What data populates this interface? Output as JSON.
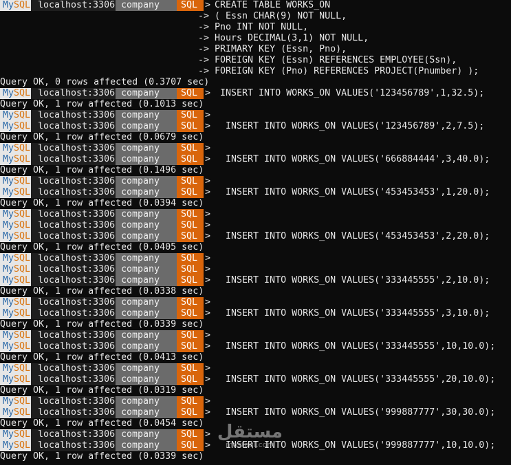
{
  "prompt": {
    "my": "My",
    "sql": "SQL",
    "host": "localhost:3306",
    "db": "company",
    "mode": "SQL",
    "arrow": ">"
  },
  "create_table": {
    "first": "CREATE TABLE WORKS_ON",
    "continuation_prefix": "->",
    "continuations": [
      "( Essn CHAR(9) NOT NULL,",
      "Pno INT NOT NULL,",
      "Hours DECIMAL(3,1) NOT NULL,",
      "PRIMARY KEY (Essn, Pno),",
      "FOREIGN KEY (Essn) REFERENCES EMPLOYEE(Ssn),",
      "FOREIGN KEY (Pno) REFERENCES PROJECT(Pnumber) );"
    ],
    "result": "Query OK, 0 rows affected (0.3707 sec)"
  },
  "inserts": [
    {
      "empty_prompts": 0,
      "command": "INSERT INTO WORKS_ON VALUES('123456789',1,32.5);",
      "result": "Query OK, 1 row affected (0.1013 sec)"
    },
    {
      "empty_prompts": 1,
      "command": "INSERT INTO WORKS_ON VALUES('123456789',2,7.5);",
      "result": "Query OK, 1 row affected (0.0679 sec)"
    },
    {
      "empty_prompts": 1,
      "command": "INSERT INTO WORKS_ON VALUES('666884444',3,40.0);",
      "result": "Query OK, 1 row affected (0.1496 sec)"
    },
    {
      "empty_prompts": 1,
      "command": "INSERT INTO WORKS_ON VALUES('453453453',1,20.0);",
      "result": "Query OK, 1 row affected (0.0394 sec)"
    },
    {
      "empty_prompts": 2,
      "command": "INSERT INTO WORKS_ON VALUES('453453453',2,20.0);",
      "result": "Query OK, 1 row affected (0.0405 sec)"
    },
    {
      "empty_prompts": 2,
      "command": "INSERT INTO WORKS_ON VALUES('333445555',2,10.0);",
      "result": "Query OK, 1 row affected (0.0338 sec)"
    },
    {
      "empty_prompts": 1,
      "command": "INSERT INTO WORKS_ON VALUES('333445555',3,10.0);",
      "result": "Query OK, 1 row affected (0.0339 sec)"
    },
    {
      "empty_prompts": 1,
      "command": "INSERT INTO WORKS_ON VALUES('333445555',10,10.0);",
      "result": "Query OK, 1 row affected (0.0413 sec)"
    },
    {
      "empty_prompts": 1,
      "command": "INSERT INTO WORKS_ON VALUES('333445555',20,10.0);",
      "result": "Query OK, 1 row affected (0.0319 sec)"
    },
    {
      "empty_prompts": 1,
      "command": "INSERT INTO WORKS_ON VALUES('999887777',30,30.0);",
      "result": "Query OK, 1 row affected (0.0454 sec)"
    },
    {
      "empty_prompts": 1,
      "command": "INSERT INTO WORKS_ON VALUES('999887777',10,10.0);",
      "result": "Query OK, 1 row affected (0.0339 sec)"
    }
  ],
  "watermark": {
    "arabic": "مستقل",
    "latin": "mostaql.com"
  },
  "colors": {
    "background": "#0c0c0c",
    "text": "#e6e6e6",
    "prompt_my": "#2d6aa8",
    "prompt_sql_accent": "#d9650b",
    "prompt_db_bg": "#6b6b6b"
  }
}
